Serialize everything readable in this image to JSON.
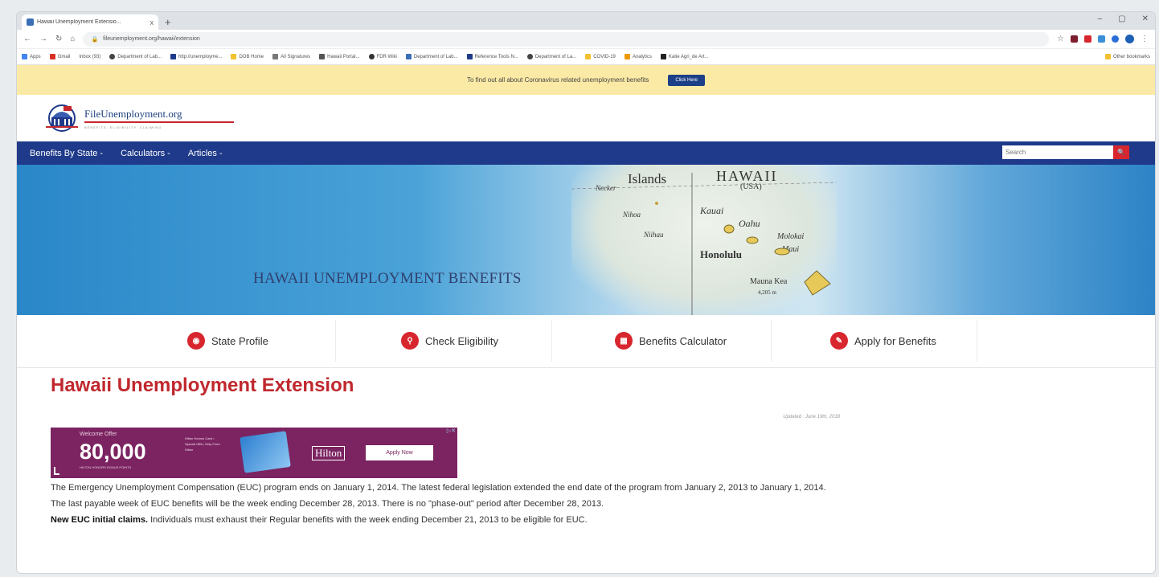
{
  "browser": {
    "tab_title": "Hawaii Unemployment Extensio...",
    "tab_close": "x",
    "new_tab": "+",
    "window_controls": [
      "–",
      "▢",
      "✕"
    ],
    "url": "fileunemployment.org/hawaii/extension",
    "bookmarks": [
      "Apps",
      "Gmail",
      "Inbox (93)",
      "Department of Lab...",
      "http://unemployme...",
      "DOB Home",
      "All Signatures",
      "Hawaii Portal...",
      "FDR Wiki",
      "Department of Lab...",
      "Reference Tools N...",
      "Department of La...",
      "COVID-19",
      "Analytics",
      "Katie Agri_de Art...",
      "Other bookmarks"
    ]
  },
  "announcement": {
    "text": "To find out all about Coronavirus related unemployment benefits",
    "button": "Click Here"
  },
  "logo": {
    "name": "FileUnemployment.org",
    "tagline": "BENEFITS, ELIGIBILITY, CLAIMING"
  },
  "nav": {
    "items": [
      "Benefits By State -",
      "Calculators -",
      "Articles -"
    ],
    "search_placeholder": "Search",
    "search_icon": "magnifier"
  },
  "hero": {
    "title": "HAWAII UNEMPLOYMENT BENEFITS",
    "map_labels": [
      "Islands",
      "HAWAII",
      "(USA)",
      "Necker",
      "Nihoa",
      "Kauai",
      "Niihau",
      "Oahu",
      "Molokai",
      "Honolulu",
      "Maui",
      "Mauna Kea",
      "4,205 m"
    ]
  },
  "quicklinks": [
    {
      "label": "State Profile",
      "icon": "us-map-icon"
    },
    {
      "label": "Check Eligibility",
      "icon": "search-icon"
    },
    {
      "label": "Benefits Calculator",
      "icon": "calculator-icon"
    },
    {
      "label": "Apply for Benefits",
      "icon": "edit-icon"
    }
  ],
  "content": {
    "title": "Hawaii Unemployment Extension",
    "updated": "Updated : June 19th, 2018",
    "ad": {
      "offer": "Welcome Offer",
      "points": "80,000",
      "points_sub": "HILTON HONORS BONUS POINTS",
      "mini": "Hilton Honors Card • Special Offer, Only From Hilton",
      "brand": "Hilton",
      "cta": "Apply Now"
    },
    "paragraphs": [
      "The Emergency Unemployment Compensation (EUC) program ends on January 1, 2014. The latest federal legislation extended the end date of the program from January 2, 2013 to January 1, 2014.",
      "The last payable week of EUC benefits will be the week ending December 28, 2013.  There is no \"phase-out\" period after December 28, 2013."
    ],
    "para3_bold": "New EUC initial claims.",
    "para3_rest": " Individuals must exhaust their Regular benefits with the week ending December 21, 2013 to be eligible for EUC."
  }
}
